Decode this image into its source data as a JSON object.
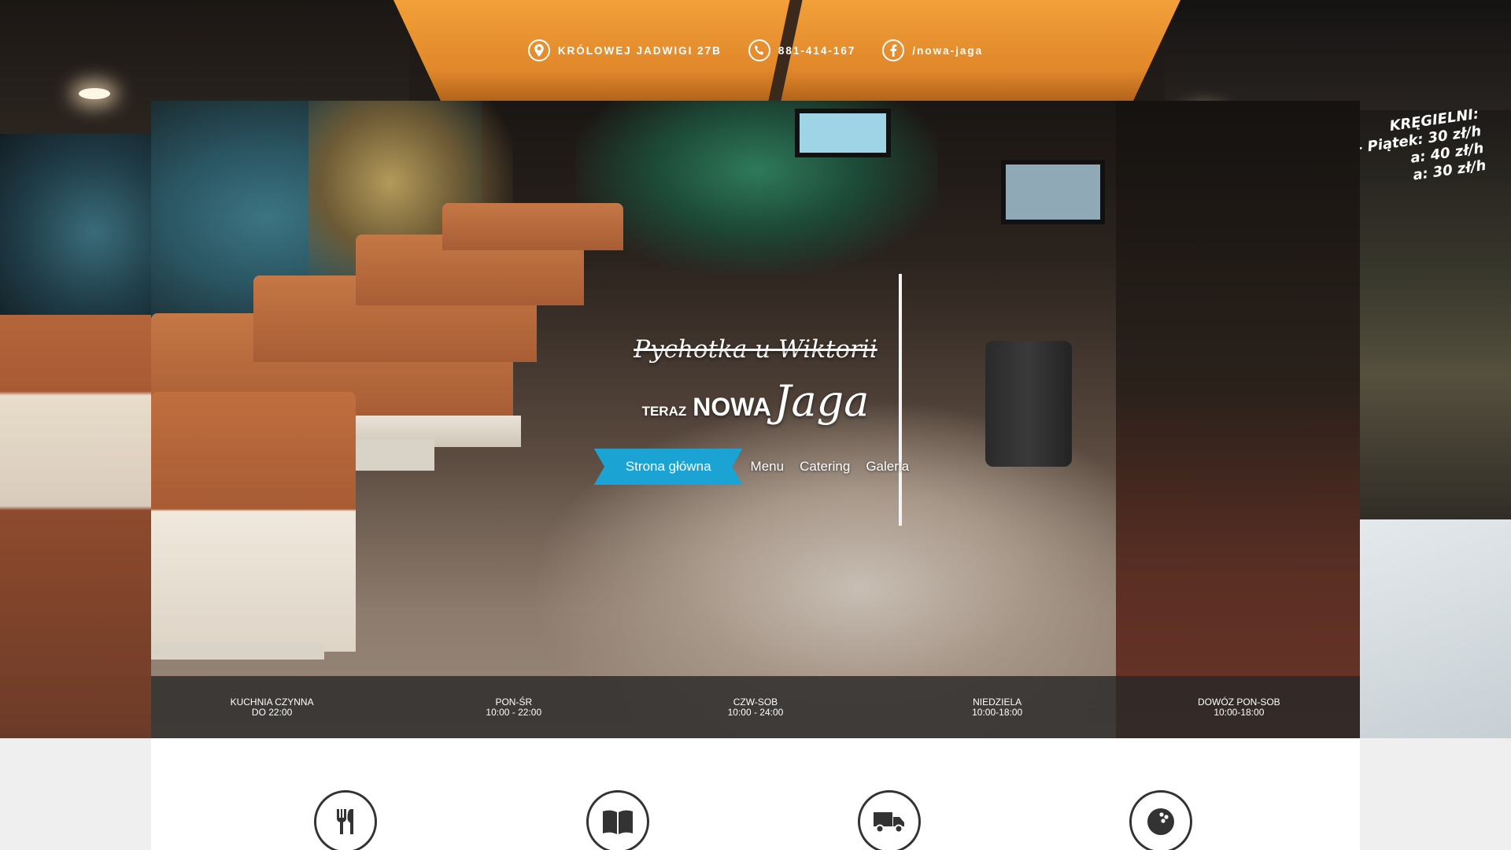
{
  "contact": {
    "address": "KRÓLOWEJ JADWIGI 27B",
    "phone": "881-414-167",
    "facebook": "/nowa-jaga"
  },
  "background_sign": {
    "line1": "KRĘGIELNI:",
    "line2": "- Piątek: 30 zł/h",
    "line3": "a: 40 zł/h",
    "line4": "a: 30 zł/h"
  },
  "logo": {
    "old_name": "Pychotka u Wiktorii",
    "prefix": "TERAZ",
    "nowa": "NOWA",
    "jaga": "Jaga"
  },
  "nav": {
    "items": [
      {
        "label": "Strona główna",
        "active": true
      },
      {
        "label": "Menu",
        "active": false
      },
      {
        "label": "Catering",
        "active": false
      },
      {
        "label": "Galeria",
        "active": false
      }
    ]
  },
  "hours": [
    {
      "title": "KUCHNIA CZYNNA",
      "value": "DO 22:00"
    },
    {
      "title": "PON-ŚR",
      "value": "10:00 - 22:00"
    },
    {
      "title": "CZW-SOB",
      "value": "10:00 - 24:00"
    },
    {
      "title": "NIEDZIELA",
      "value": "10:00-18:00"
    },
    {
      "title": "DOWÓZ PON-SOB",
      "value": "10:00-18:00"
    }
  ],
  "features": [
    {
      "icon": "fork-knife-icon"
    },
    {
      "icon": "book-icon"
    },
    {
      "icon": "truck-icon"
    },
    {
      "icon": "bowling-ball-icon"
    }
  ],
  "colors": {
    "accent": "#1aa3d3",
    "hours_bar": "#282828",
    "icon_stroke": "#333333"
  }
}
